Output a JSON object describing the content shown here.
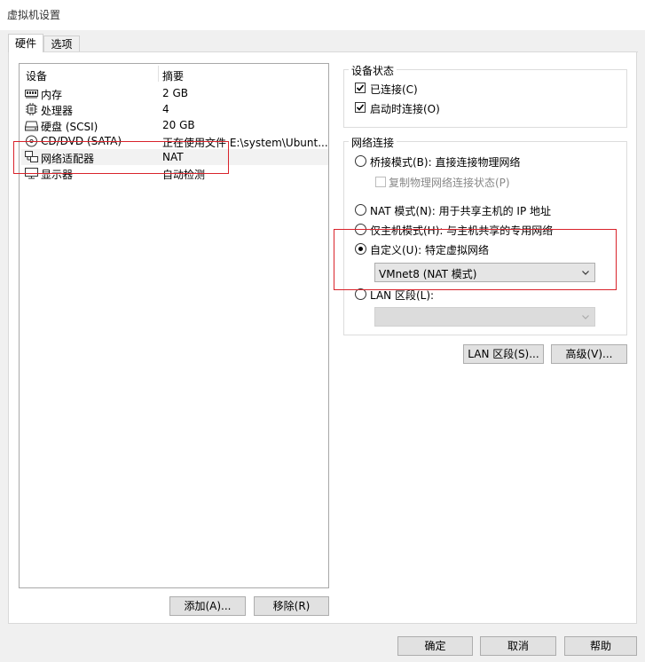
{
  "window": {
    "title": "虚拟机设置"
  },
  "tabs": [
    {
      "label": "硬件"
    },
    {
      "label": "选项"
    }
  ],
  "devices": {
    "header_device": "设备",
    "header_summary": "摘要",
    "rows": [
      {
        "name": "内存",
        "summary": "2 GB",
        "icon": "memory-icon"
      },
      {
        "name": "处理器",
        "summary": "4",
        "icon": "cpu-icon"
      },
      {
        "name": "硬盘 (SCSI)",
        "summary": "20 GB",
        "icon": "harddisk-icon"
      },
      {
        "name": "CD/DVD (SATA)",
        "summary": "正在使用文件 E:\\system\\Ubunt...",
        "icon": "cd-dvd-icon"
      },
      {
        "name": "网络适配器",
        "summary": "NAT",
        "icon": "network-adapter-icon"
      },
      {
        "name": "显示器",
        "summary": "自动检测",
        "icon": "display-icon"
      }
    ],
    "add_label": "添加(A)...",
    "remove_label": "移除(R)"
  },
  "device_status": {
    "title": "设备状态",
    "connected_label": "已连接(C)",
    "connected_checked": true,
    "connect_on_power_label": "启动时连接(O)",
    "connect_on_power_checked": true
  },
  "network": {
    "title": "网络连接",
    "bridged_label": "桥接模式(B): 直接连接物理网络",
    "replicate_label": "复制物理网络连接状态(P)",
    "nat_label": "NAT 模式(N): 用于共享主机的 IP 地址",
    "hostonly_label": "仅主机模式(H): 与主机共享的专用网络",
    "custom_label": "自定义(U): 特定虚拟网络",
    "selected": "custom",
    "custom_value": "VMnet8 (NAT 模式)",
    "lan_label": "LAN 区段(L):",
    "lan_value": ""
  },
  "buttons": {
    "lan_segments": "LAN 区段(S)...",
    "advanced": "高级(V)...",
    "ok": "确定",
    "cancel": "取消",
    "help": "帮助"
  },
  "colors": {
    "highlight_box": "#d9232b"
  }
}
